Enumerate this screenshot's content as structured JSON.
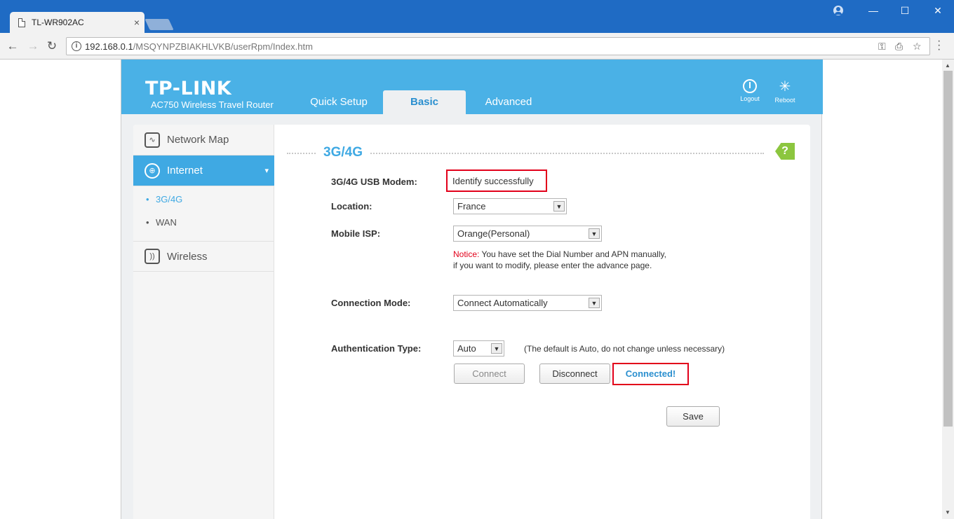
{
  "browser": {
    "tab_title": "TL-WR902AC",
    "tab_close": "×",
    "url_host": "192.168.0.1",
    "url_path": "/MSQYNPZBIAKHLVKB/userRpm/Index.htm",
    "icons": [
      "back-icon",
      "forward-icon",
      "reload-icon",
      "info-icon",
      "key-icon",
      "translate-icon",
      "star-icon",
      "menu-icon"
    ],
    "window_controls": {
      "minimize": "—",
      "maximize": "☐",
      "close": "✕"
    }
  },
  "header": {
    "logo": "TP-LINK",
    "model": "AC750 Wireless Travel Router",
    "tabs": [
      {
        "label": "Quick Setup",
        "active": false
      },
      {
        "label": "Basic",
        "active": true
      },
      {
        "label": "Advanced",
        "active": false
      }
    ],
    "logout_label": "Logout",
    "reboot_label": "Reboot"
  },
  "sidebar": {
    "items": [
      {
        "label": "Network Map",
        "icon": "network-map-icon"
      },
      {
        "label": "Internet",
        "icon": "globe-icon",
        "active": true
      },
      {
        "label": "Wireless",
        "icon": "wireless-icon"
      }
    ],
    "subitems": [
      {
        "label": "3G/4G",
        "active": true
      },
      {
        "label": "WAN",
        "active": false
      }
    ]
  },
  "section": {
    "title": "3G/4G",
    "help": "?"
  },
  "form": {
    "modem_label": "3G/4G USB Modem:",
    "modem_value": "Identify successfully",
    "location_label": "Location:",
    "location_value": "France",
    "isp_label": "Mobile ISP:",
    "isp_value": "Orange(Personal)",
    "notice_prefix": "Notice:",
    "notice_line1": " You have set the Dial Number and APN manually,",
    "notice_line2": "if you want to modify, please enter the advance page.",
    "mode_label": "Connection Mode:",
    "mode_value": "Connect Automatically",
    "auth_label": "Authentication Type:",
    "auth_value": "Auto",
    "auth_hint": "(The default is Auto, do not change unless necessary)",
    "connect_label": "Connect",
    "disconnect_label": "Disconnect",
    "status_text": "Connected!",
    "save_label": "Save"
  },
  "colors": {
    "browser_blue": "#1f6bc4",
    "header_blue": "#4ab1e6",
    "accent_blue": "#3fa9e3",
    "highlight_red": "#e2001a",
    "help_green": "#8cc63f"
  }
}
